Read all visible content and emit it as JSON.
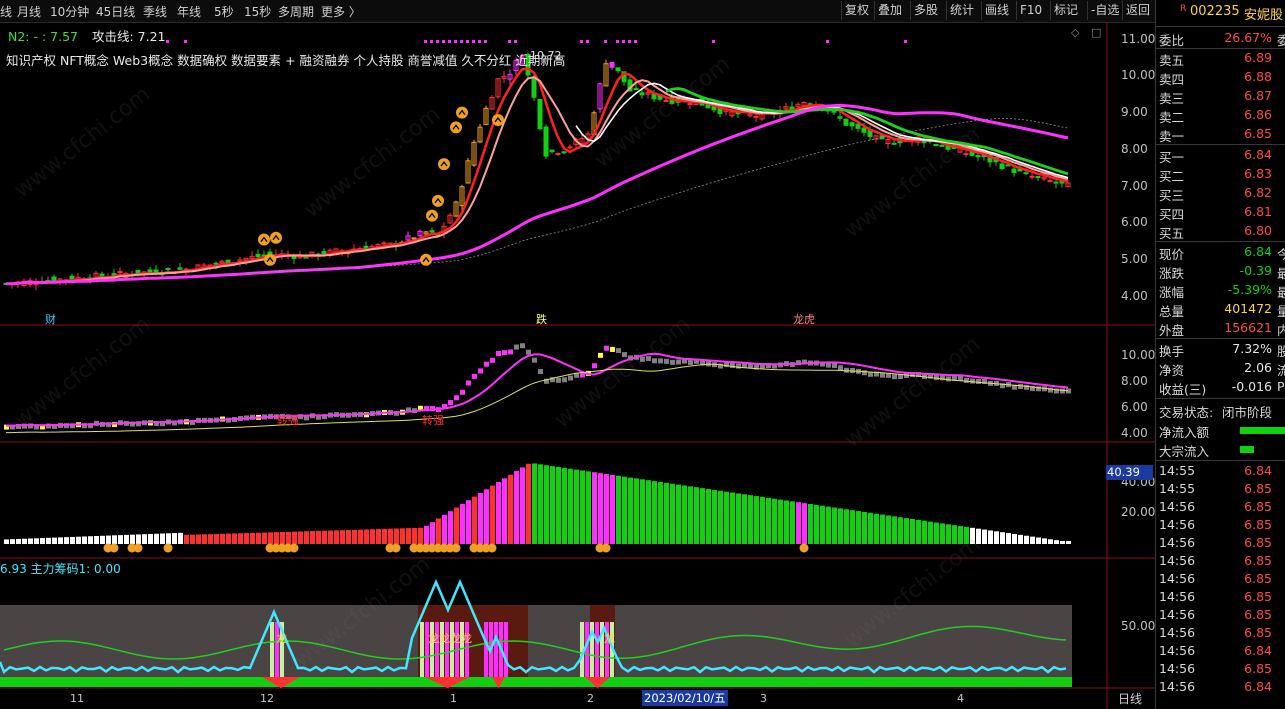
{
  "toolbar": {
    "periods": [
      "线",
      "月线",
      "10分钟",
      "45日线",
      "季线",
      "年线",
      "5秒",
      "15秒",
      "多周期",
      "更多"
    ],
    "buttons": [
      "复权",
      "叠加",
      "多股",
      "统计",
      "画线",
      "F10",
      "标记",
      "-自选",
      "返回"
    ]
  },
  "main": {
    "legend_n2": "N2: - : 7.57",
    "legend_attack": "攻击线: 7.21",
    "concepts": "知识产权 NFT概念 Web3概念 数据确权 数据要素 + 融资融券 个人持股 商誉减值 久不分红 近期新高",
    "price_axis": [
      "11.00",
      "10.00",
      "9.00",
      "8.00",
      "7.00",
      "6.00",
      "5.00",
      "4.00"
    ],
    "event_labels": {
      "cai": "财",
      "die": "跌",
      "longhu": "龙虎"
    },
    "peak_label": "10.72"
  },
  "sub1": {
    "axis": [
      "10.00",
      "8.00",
      "6.00",
      "4.00"
    ],
    "tag1": "转强",
    "tag2": "转强"
  },
  "sub2": {
    "axis": [
      "40.00",
      "20.00"
    ],
    "current_value": "40.39"
  },
  "sub3": {
    "legend": "6.93 主力筹码1: 0.00",
    "axis": [
      "50.00"
    ],
    "dragon_labels": [
      "龙",
      "龙龙龙龙",
      "龙"
    ]
  },
  "xaxis": {
    "labels": [
      "11",
      "12",
      "1",
      "2",
      "3",
      "4"
    ],
    "cursor_date": "2023/02/10/五",
    "period": "日线"
  },
  "quote": {
    "flag": "R",
    "code": "002235",
    "name": "安妮股",
    "weibi_label": "委比",
    "weibi_value": "26.67%",
    "weibi_tail": "委",
    "asks": [
      {
        "label": "卖五",
        "price": "6.89"
      },
      {
        "label": "卖四",
        "price": "6.88"
      },
      {
        "label": "卖三",
        "price": "6.87"
      },
      {
        "label": "卖二",
        "price": "6.86"
      },
      {
        "label": "卖一",
        "price": "6.85"
      }
    ],
    "bids": [
      {
        "label": "买一",
        "price": "6.84"
      },
      {
        "label": "买二",
        "price": "6.83"
      },
      {
        "label": "买三",
        "price": "6.82"
      },
      {
        "label": "买四",
        "price": "6.81"
      },
      {
        "label": "买五",
        "price": "6.80"
      }
    ],
    "stats": [
      {
        "label": "现价",
        "value": "6.84",
        "tail": "今",
        "color": "down"
      },
      {
        "label": "涨跌",
        "value": "-0.39",
        "tail": "最",
        "color": "down"
      },
      {
        "label": "涨幅",
        "value": "-5.39%",
        "tail": "最",
        "color": "down"
      },
      {
        "label": "总量",
        "value": "401472",
        "tail": "量",
        "color": "yel"
      },
      {
        "label": "外盘",
        "value": "156621",
        "tail": "内",
        "color": "up"
      }
    ],
    "stats2": [
      {
        "label": "换手",
        "value": "7.32%",
        "tail": "股"
      },
      {
        "label": "净资",
        "value": "2.06",
        "tail": "流"
      },
      {
        "label": "收益(三)",
        "value": "-0.016",
        "tail": "P"
      }
    ],
    "trade_state_label": "交易状态:",
    "trade_state": "闭市阶段",
    "net_inflow_label": "净流入额",
    "block_inflow_label": "大宗流入",
    "ticks": [
      {
        "time": "14:55",
        "price": "6.84"
      },
      {
        "time": "14:55",
        "price": "6.85"
      },
      {
        "time": "14:56",
        "price": "6.85"
      },
      {
        "time": "14:56",
        "price": "6.85"
      },
      {
        "time": "14:56",
        "price": "6.85"
      },
      {
        "time": "14:56",
        "price": "6.85"
      },
      {
        "time": "14:56",
        "price": "6.85"
      },
      {
        "time": "14:56",
        "price": "6.85"
      },
      {
        "time": "14:56",
        "price": "6.85"
      },
      {
        "time": "14:56",
        "price": "6.85"
      },
      {
        "time": "14:56",
        "price": "6.84"
      },
      {
        "time": "14:56",
        "price": "6.85"
      },
      {
        "time": "14:56",
        "price": "6.84"
      }
    ]
  },
  "colors": {
    "up": "#ff3030",
    "down": "#10d010",
    "magenta": "#ff30ff",
    "yellow": "#ffff40",
    "orange": "#f0a020",
    "cyan": "#40e8ff"
  },
  "watermark": "www.cfchi.com"
}
